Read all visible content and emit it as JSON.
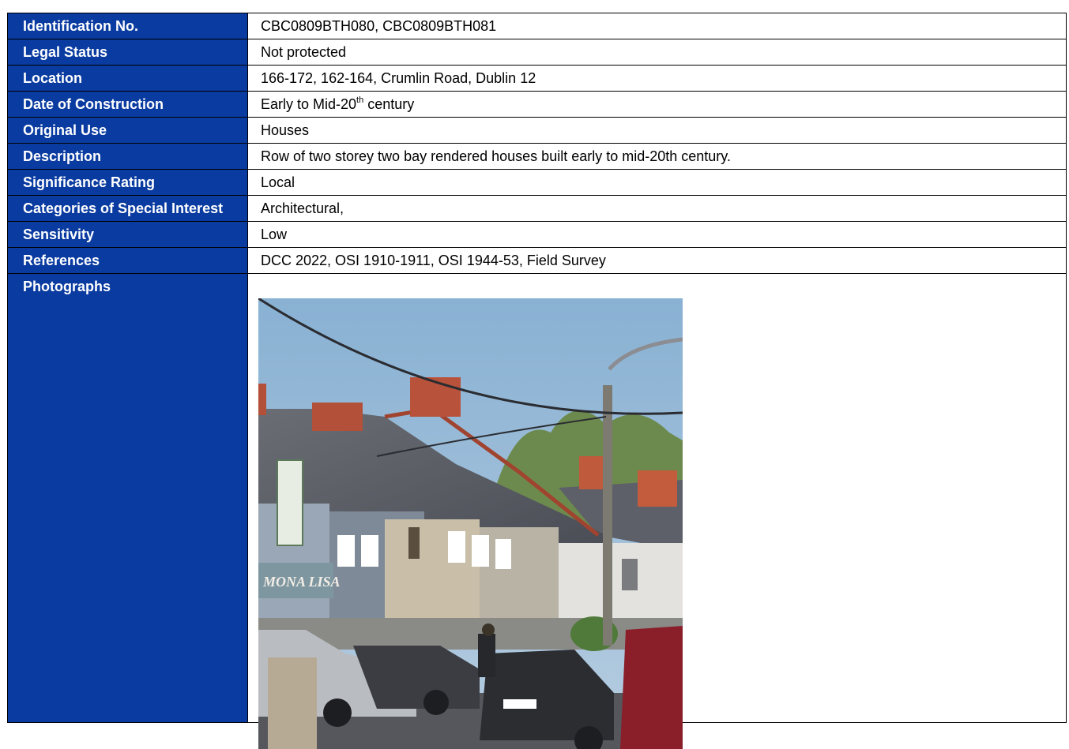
{
  "rows": [
    {
      "label": "Identification No.",
      "value": "CBC0809BTH080, CBC0809BTH081"
    },
    {
      "label": "Legal Status",
      "value": "Not protected"
    },
    {
      "label": "Location",
      "value": "166-172, 162-164, Crumlin Road, Dublin 12"
    },
    {
      "label": "Date of Construction",
      "value_pre": "Early to Mid-20",
      "value_sup": "th",
      "value_post": " century"
    },
    {
      "label": "Original Use",
      "value": "Houses"
    },
    {
      "label": "Description",
      "value": "Row of two storey two bay rendered houses built early to mid-20th century."
    },
    {
      "label": "Significance Rating",
      "value": "Local"
    },
    {
      "label": "Categories of Special Interest",
      "value": "Architectural,"
    },
    {
      "label": "Sensitivity",
      "value": "Low"
    },
    {
      "label": "References",
      "value": "DCC 2022, OSI 1910-1911, OSI 1944-53, Field Survey"
    },
    {
      "label": "Photographs"
    }
  ],
  "photo": {
    "sign_text": "MONA LISA",
    "colors": {
      "sky": "#8fb4d4",
      "roof": "#5b5e66",
      "chimney": "#b9523a",
      "render": "#c9bfa9",
      "car": "#2b2d31",
      "van": "#8a1f2a"
    }
  }
}
